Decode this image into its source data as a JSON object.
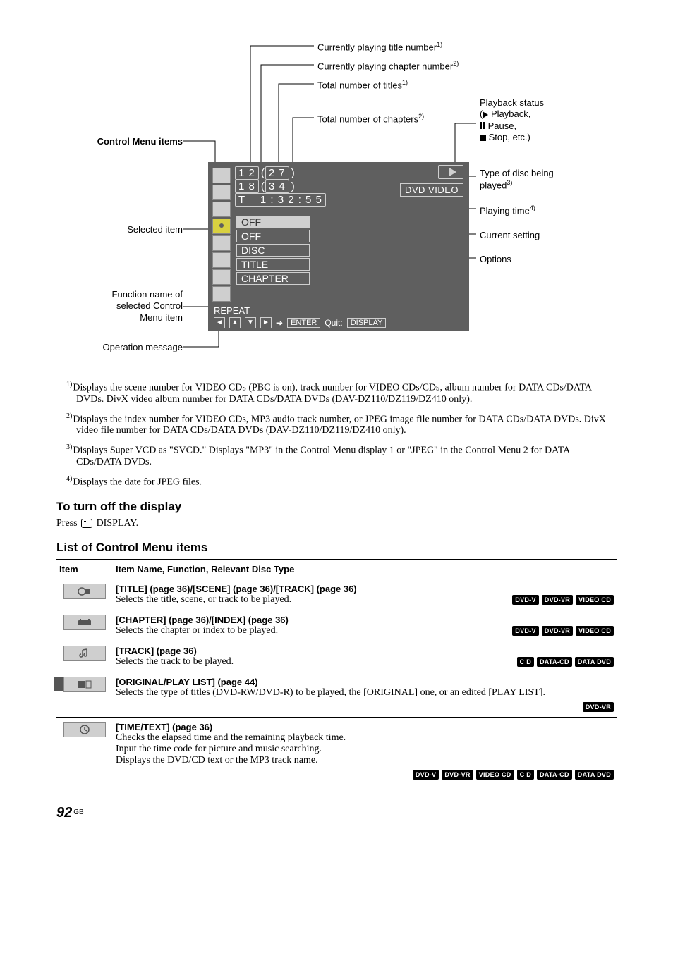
{
  "diagram": {
    "labels": {
      "title_num": "Currently playing title number",
      "chapter_num": "Currently playing chapter number",
      "total_titles": "Total number of titles",
      "total_chapters": "Total number of chapters",
      "control_menu": "Control Menu items",
      "selected_item": "Selected item",
      "function_name": "Function name of selected Control Menu item",
      "operation_message": "Operation message",
      "playback_status": "Playback status",
      "playback_play": "Playback,",
      "playback_pause": "Pause,",
      "playback_stop": "Stop, etc.)",
      "disc_type": "Type of disc being played",
      "playing_time": "Playing time",
      "current_setting": "Current setting",
      "options": "Options"
    },
    "panel": {
      "title_cur": "1 2",
      "title_tot": "2 7",
      "chap_cur": "1 8",
      "chap_tot": "3 4",
      "time_t": "T",
      "time": "1 : 3 2 : 5 5",
      "disc": "DVD VIDEO",
      "opt_off1": "OFF",
      "opt_off2": "OFF",
      "opt_disc": "DISC",
      "opt_title": "TITLE",
      "opt_chapter": "CHAPTER",
      "fn": "REPEAT",
      "enter": "ENTER",
      "quit": "Quit:",
      "display": "DISPLAY"
    }
  },
  "footnotes": {
    "f1": "Displays the scene number for VIDEO CDs (PBC is on), track number for VIDEO CDs/CDs, album number for DATA CDs/DATA DVDs. DivX video album number for DATA CDs/DATA DVDs (DAV-DZ110/DZ119/DZ410 only).",
    "f2": "Displays the index number for VIDEO CDs, MP3 audio track number, or JPEG image file number for DATA CDs/DATA DVDs. DivX video file number for DATA CDs/DATA DVDs (DAV-DZ110/DZ119/DZ410 only).",
    "f3": "Displays Super VCD as \"SVCD.\" Displays \"MP3\" in the Control Menu display 1 or \"JPEG\" in the Control Menu 2 for DATA CDs/DATA DVDs.",
    "f4": "Displays the date for JPEG files."
  },
  "sections": {
    "turn_off": "To turn off the display",
    "press": "Press ",
    "display_word": " DISPLAY.",
    "list": "List of Control Menu items"
  },
  "table": {
    "headers": {
      "item": "Item",
      "name": "Item Name, Function, Relevant Disc Type"
    },
    "rows": [
      {
        "title": "[TITLE] (page 36)/[SCENE] (page 36)/[TRACK] (page 36)",
        "desc": "Selects the title, scene, or track to be played.",
        "badges": [
          "DVD-V",
          "DVD-VR",
          "VIDEO CD"
        ]
      },
      {
        "title": "[CHAPTER] (page 36)/[INDEX] (page 36)",
        "desc": "Selects the chapter or index to be played.",
        "badges": [
          "DVD-V",
          "DVD-VR",
          "VIDEO CD"
        ]
      },
      {
        "title": "[TRACK] (page 36)",
        "desc": "Selects the track to be played.",
        "badges": [
          "C D",
          "DATA-CD",
          "DATA DVD"
        ]
      },
      {
        "title": "[ORIGINAL/PLAY LIST] (page 44)",
        "desc": "Selects the type of titles (DVD-RW/DVD-R) to be played, the [ORIGINAL] one, or an edited [PLAY LIST].",
        "badges": [
          "DVD-VR"
        ]
      },
      {
        "title": "[TIME/TEXT] (page 36)",
        "desc_lines": [
          "Checks the elapsed time and the remaining playback time.",
          "Input the time code for picture and music searching.",
          "Displays the DVD/CD text or the MP3 track name."
        ],
        "badges": [
          "DVD-V",
          "DVD-VR",
          "VIDEO CD",
          "C D",
          "DATA-CD",
          "DATA DVD"
        ]
      }
    ]
  },
  "page_number": "92",
  "page_suffix": "GB"
}
